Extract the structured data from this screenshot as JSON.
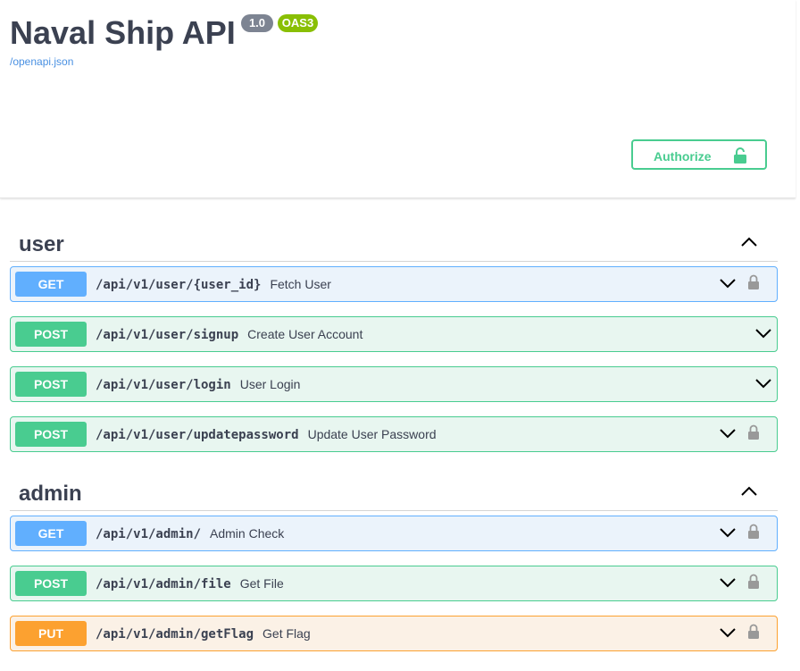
{
  "info": {
    "title": "Naval Ship API",
    "version": "1.0",
    "oas_badge": "OAS3",
    "spec_link": "/openapi.json"
  },
  "authorize": {
    "label": "Authorize"
  },
  "colors": {
    "get": "#61affe",
    "post": "#49cc90",
    "put": "#fca130",
    "authorize": "#49cc90"
  },
  "tags": [
    {
      "name": "user",
      "operations": [
        {
          "method": "GET",
          "path": "/api/v1/user/{user_id}",
          "summary": "Fetch User",
          "locked": true
        },
        {
          "method": "POST",
          "path": "/api/v1/user/signup",
          "summary": "Create User Account",
          "locked": false
        },
        {
          "method": "POST",
          "path": "/api/v1/user/login",
          "summary": "User Login",
          "locked": false
        },
        {
          "method": "POST",
          "path": "/api/v1/user/updatepassword",
          "summary": "Update User Password",
          "locked": true
        }
      ]
    },
    {
      "name": "admin",
      "operations": [
        {
          "method": "GET",
          "path": "/api/v1/admin/",
          "summary": "Admin Check",
          "locked": true
        },
        {
          "method": "POST",
          "path": "/api/v1/admin/file",
          "summary": "Get File",
          "locked": true
        },
        {
          "method": "PUT",
          "path": "/api/v1/admin/getFlag",
          "summary": "Get Flag",
          "locked": true
        }
      ]
    }
  ]
}
